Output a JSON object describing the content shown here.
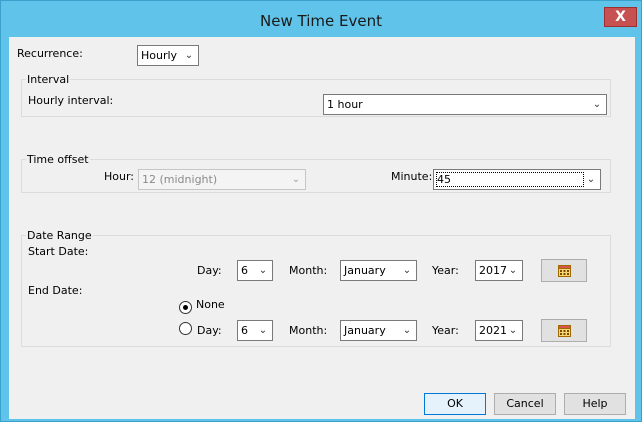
{
  "dialog": {
    "title": "New Time Event",
    "close_glyph": "X"
  },
  "recurrence": {
    "label": "Recurrence:",
    "value": "Hourly"
  },
  "interval": {
    "group_title": "Interval",
    "hourly_label": "Hourly interval:",
    "hourly_value": "1 hour"
  },
  "time_offset": {
    "group_title": "Time offset",
    "hour_label": "Hour:",
    "hour_value": "12 (midnight)",
    "minute_label": "Minute:",
    "minute_value": "45"
  },
  "date_range": {
    "group_title": "Date Range",
    "start_label": "Start Date:",
    "end_label": "End Date:",
    "start": {
      "day_label": "Day:",
      "day_value": "6",
      "month_label": "Month:",
      "month_value": "January",
      "year_label": "Year:",
      "year_value": "2017"
    },
    "end": {
      "none_label": "None",
      "day_label": "Day:",
      "day_value": "6",
      "month_label": "Month:",
      "month_value": "January",
      "year_label": "Year:",
      "year_value": "2021",
      "selected": "none"
    }
  },
  "buttons": {
    "ok": "OK",
    "cancel": "Cancel",
    "help": "Help"
  },
  "icons": {
    "dropdown": "chevron-down-icon",
    "calendar": "calendar-icon",
    "close": "close-icon"
  },
  "colors": {
    "titlebar": "#60c3e9",
    "close": "#c75050",
    "client": "#f0f0f0"
  }
}
